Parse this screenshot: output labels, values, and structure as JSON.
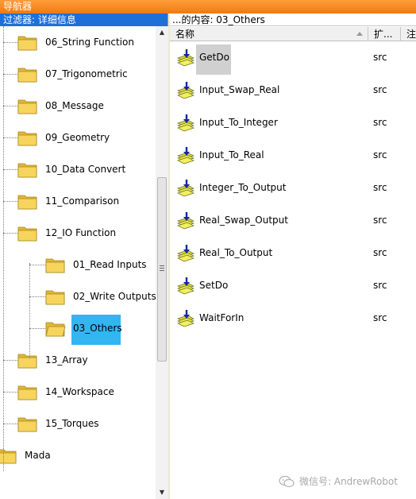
{
  "window": {
    "title": "导航器"
  },
  "filter": {
    "label": "过滤器: 详细信息"
  },
  "path": {
    "label": "...的内容: 03_Others"
  },
  "tree": {
    "items": [
      {
        "label": "06_String Function",
        "level": 0
      },
      {
        "label": "07_Trigonometric",
        "level": 0
      },
      {
        "label": "08_Message",
        "level": 0
      },
      {
        "label": "09_Geometry",
        "level": 0
      },
      {
        "label": "10_Data Convert",
        "level": 0
      },
      {
        "label": "11_Comparison",
        "level": 0
      },
      {
        "label": "12_IO Function",
        "level": 0
      },
      {
        "label": "01_Read Inputs",
        "level": 1
      },
      {
        "label": "02_Write Outputs",
        "level": 1
      },
      {
        "label": "03_Others",
        "level": 1,
        "selected": true
      },
      {
        "label": "13_Array",
        "level": 0
      },
      {
        "label": "14_Workspace",
        "level": 0
      },
      {
        "label": "15_Torques",
        "level": 0
      },
      {
        "label": "Mada",
        "level": -1
      }
    ],
    "selected_color": "#33b5f0"
  },
  "columns": {
    "name": "名称",
    "ext": "扩...",
    "comment": "注"
  },
  "files": [
    {
      "name": "GetDo",
      "ext": "src",
      "highlighted": true
    },
    {
      "name": "Input_Swap_Real",
      "ext": "src"
    },
    {
      "name": "Input_To_Integer",
      "ext": "src"
    },
    {
      "name": "Input_To_Real",
      "ext": "src"
    },
    {
      "name": "Integer_To_Output",
      "ext": "src"
    },
    {
      "name": "Real_Swap_Output",
      "ext": "src"
    },
    {
      "name": "Real_To_Output",
      "ext": "src"
    },
    {
      "name": "SetDo",
      "ext": "src"
    },
    {
      "name": "WaitForIn",
      "ext": "src"
    }
  ],
  "watermark": {
    "text": "微信号: AndrewRobot"
  },
  "colors": {
    "titlebar": "#f07a10",
    "filterbar": "#1f6fd8",
    "folder": "#f7d45c"
  }
}
